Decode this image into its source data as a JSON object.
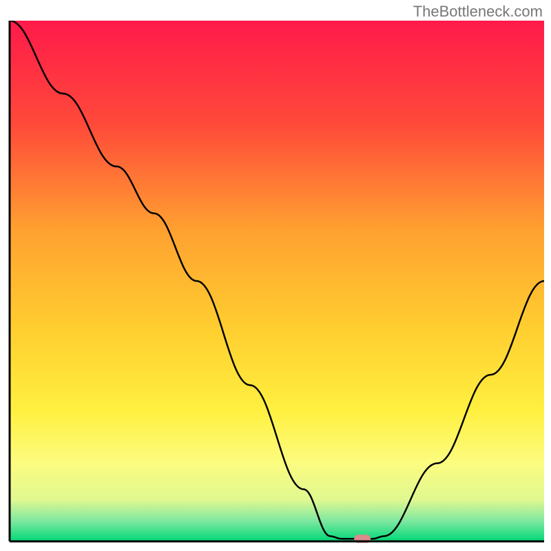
{
  "watermark": "TheBottleneck.com",
  "chart_data": {
    "type": "line",
    "title": "",
    "xlabel": "",
    "ylabel": "",
    "xlim": [
      0,
      100
    ],
    "ylim": [
      0,
      100
    ],
    "background": {
      "type": "vertical-gradient",
      "stops": [
        {
          "offset": 0,
          "color": "#ff1a4a"
        },
        {
          "offset": 20,
          "color": "#ff4a3a"
        },
        {
          "offset": 40,
          "color": "#ffa030"
        },
        {
          "offset": 60,
          "color": "#ffd030"
        },
        {
          "offset": 75,
          "color": "#fff040"
        },
        {
          "offset": 85,
          "color": "#fcfc80"
        },
        {
          "offset": 92,
          "color": "#e0f890"
        },
        {
          "offset": 96,
          "color": "#80e8a0"
        },
        {
          "offset": 100,
          "color": "#00d878"
        }
      ]
    },
    "series": [
      {
        "name": "bottleneck-curve",
        "color": "#000000",
        "points": [
          {
            "x": 0,
            "y": 100
          },
          {
            "x": 10,
            "y": 86
          },
          {
            "x": 20,
            "y": 72
          },
          {
            "x": 27,
            "y": 63
          },
          {
            "x": 35,
            "y": 50
          },
          {
            "x": 45,
            "y": 30
          },
          {
            "x": 55,
            "y": 10
          },
          {
            "x": 60,
            "y": 1
          },
          {
            "x": 62,
            "y": 0.5
          },
          {
            "x": 68,
            "y": 0.5
          },
          {
            "x": 70,
            "y": 1
          },
          {
            "x": 80,
            "y": 15
          },
          {
            "x": 90,
            "y": 32
          },
          {
            "x": 100,
            "y": 50
          }
        ]
      }
    ],
    "marker": {
      "x": 66,
      "y": 0.5,
      "color": "#d98a8a",
      "shape": "rounded-rect"
    },
    "frame": {
      "left": true,
      "bottom": true,
      "top": false,
      "right": false,
      "color": "#000000",
      "width": 3
    }
  }
}
